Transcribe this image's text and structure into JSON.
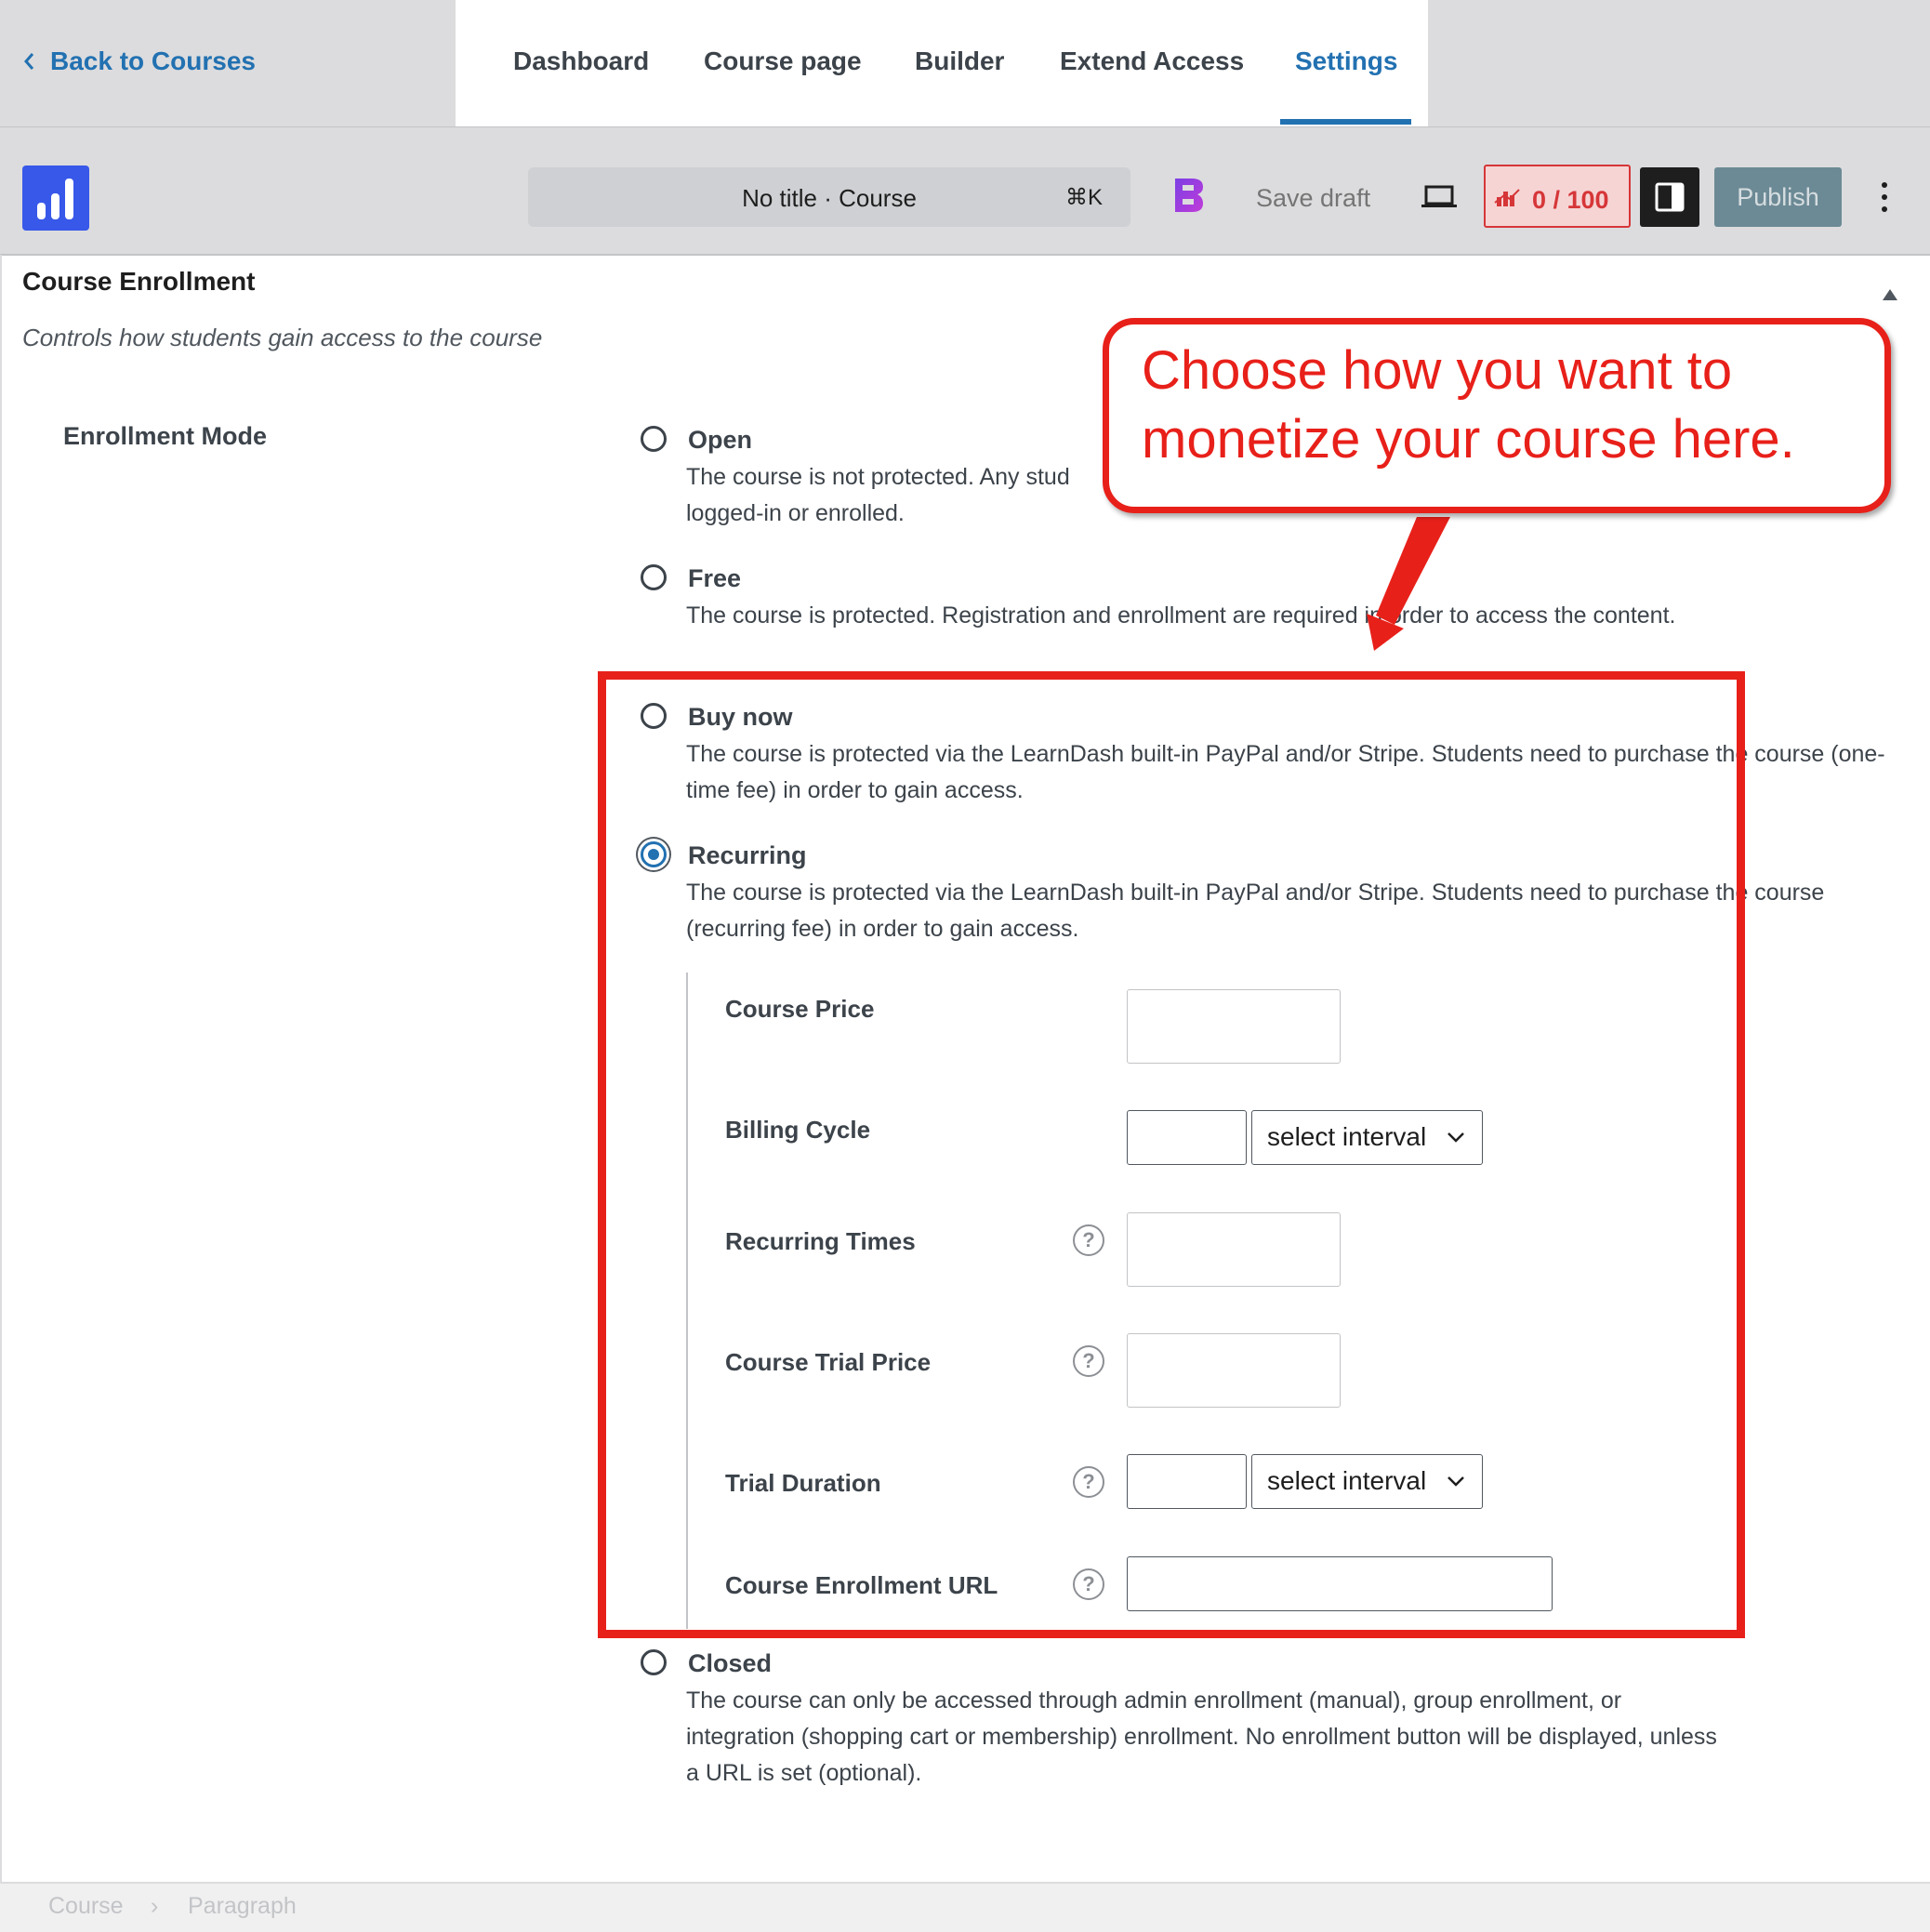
{
  "nav": {
    "back_label": "Back to Courses",
    "tabs": [
      {
        "label": "Dashboard"
      },
      {
        "label": "Course page"
      },
      {
        "label": "Builder"
      },
      {
        "label": "Extend Access"
      },
      {
        "label": "Settings"
      }
    ],
    "active_tab": "Settings"
  },
  "toolbar": {
    "command_title": "No title · Course",
    "command_shortcut": "⌘K",
    "save_draft": "Save draft",
    "score": "0 / 100",
    "publish": "Publish"
  },
  "section": {
    "title": "Course Enrollment",
    "subtitle": "Controls how students gain access to the course",
    "field_label": "Enrollment Mode"
  },
  "options": [
    {
      "label": "Open",
      "desc": "The course is not protected. Any stud",
      "desc2": "logged-in or enrolled.",
      "selected": false
    },
    {
      "label": "Free",
      "desc": "The course is protected. Registration and enrollment are required in order to access the content.",
      "selected": false
    },
    {
      "label": "Buy now",
      "desc": "The course is protected via the LearnDash built-in PayPal and/or Stripe. Students need to purchase the course (one-time fee) in order to gain access.",
      "selected": false
    },
    {
      "label": "Recurring",
      "desc": "The course is protected via the LearnDash built-in PayPal and/or Stripe. Students need to purchase the course (recurring fee) in order to gain access.",
      "selected": true
    },
    {
      "label": "Closed",
      "desc": "The course can only be accessed through admin enrollment (manual), group enrollment, or integration (shopping cart or membership) enrollment. No enrollment button will be displayed, unless a URL is set (optional).",
      "selected": false
    }
  ],
  "recurring_fields": {
    "course_price": {
      "label": "Course Price",
      "value": ""
    },
    "billing_cycle": {
      "label": "Billing Cycle",
      "value": "",
      "interval": "select interval"
    },
    "recurring_times": {
      "label": "Recurring Times",
      "value": ""
    },
    "trial_price": {
      "label": "Course Trial Price",
      "value": ""
    },
    "trial_duration": {
      "label": "Trial Duration",
      "value": "",
      "interval": "select interval"
    },
    "enrollment_url": {
      "label": "Course Enrollment URL",
      "value": ""
    }
  },
  "help_glyph": "?",
  "annotation": {
    "line1": "Choose how you want to",
    "line2": "monetize your course here."
  },
  "breadcrumb": [
    "Course",
    "Paragraph"
  ],
  "breadcrumb_sep": "›",
  "icons": [
    "chevron-left-icon",
    "site-logo-icon",
    "b-block-icon",
    "laptop-preview-icon",
    "score-chart-icon",
    "sidebar-panel-icon",
    "more-vertical-icon",
    "collapse-triangle-icon",
    "help-icon",
    "chevron-down-icon"
  ],
  "colors": {
    "accent": "#2271b1",
    "annotation_red": "#e8201a",
    "toolbar_bg": "#dcdcde",
    "publish_bg": "#6c8a95",
    "logo_blue": "#3858e9"
  }
}
